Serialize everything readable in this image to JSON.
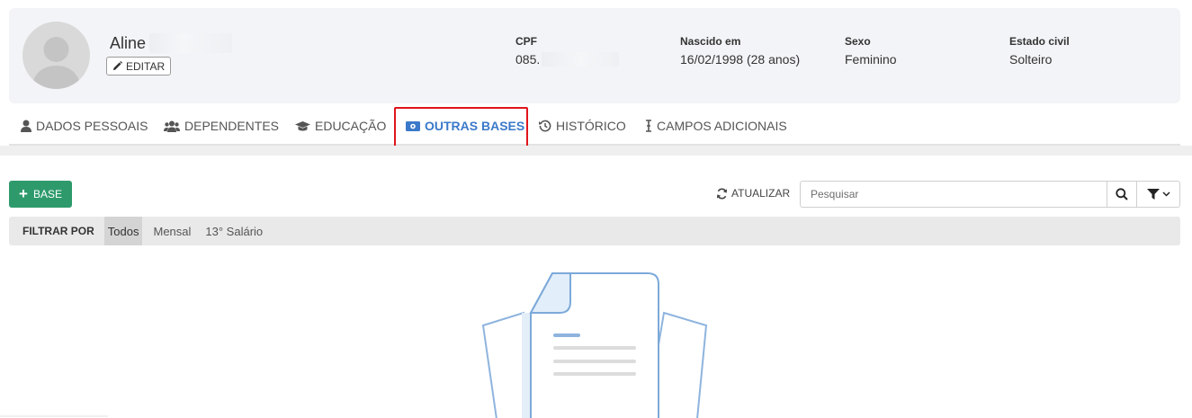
{
  "profile": {
    "first_name": "Aline",
    "edit_label": "EDITAR",
    "cpf": {
      "label": "CPF",
      "value": "085."
    },
    "birth": {
      "label": "Nascido em",
      "value": "16/02/1998 (28 anos)"
    },
    "sex": {
      "label": "Sexo",
      "value": "Feminino"
    },
    "civil": {
      "label": "Estado civil",
      "value": "Solteiro"
    }
  },
  "tabs": [
    {
      "label": "DADOS PESSOAIS",
      "icon": "user-icon"
    },
    {
      "label": "DEPENDENTES",
      "icon": "users-icon"
    },
    {
      "label": "EDUCAÇÃO",
      "icon": "graduation-cap-icon"
    },
    {
      "label": "OUTRAS BASES",
      "icon": "money-bill-icon",
      "active": true
    },
    {
      "label": "HISTÓRICO",
      "icon": "history-icon"
    },
    {
      "label": "CAMPOS ADICIONAIS",
      "icon": "text-cursor-icon"
    }
  ],
  "toolbar": {
    "add_label": "BASE",
    "refresh_label": "ATUALIZAR",
    "search_placeholder": "Pesquisar"
  },
  "filter": {
    "label": "FILTRAR POR",
    "options": [
      "Todos",
      "Mensal",
      "13° Salário"
    ],
    "selected": "Todos"
  },
  "colors": {
    "accent": "#3a79c9",
    "add_button": "#2e9a6c",
    "highlight": "#e0141b"
  }
}
